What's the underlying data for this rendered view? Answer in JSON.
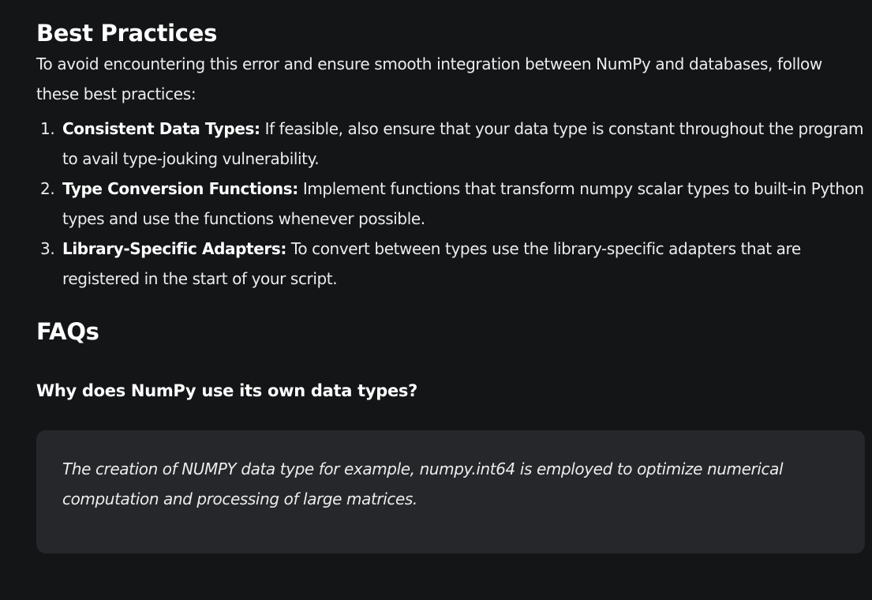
{
  "best_practices": {
    "heading": "Best Practices",
    "intro": "To avoid encountering this error and ensure smooth integration between NumPy and databases, follow these best practices:",
    "items": [
      {
        "number": "1.",
        "term": "Consistent Data Types:",
        "text": " If feasible, also ensure that your data type is constant throughout the program to avail type-jouking vulnerability."
      },
      {
        "number": "2.",
        "term": "Type Conversion Functions:",
        "text": " Implement functions that transform numpy scalar types to built-in Python types and use the functions whenever possible."
      },
      {
        "number": "3.",
        "term": "Library-Specific Adapters:",
        "text": " To convert between types use the library-specific adapters that are registered in the start of your script."
      }
    ]
  },
  "faqs": {
    "heading": "FAQs",
    "questions": [
      {
        "question": "Why does NumPy use its own data types?",
        "answer": "The creation of NUMPY data type for example, numpy.int64 is employed to optimize numerical computation and processing of large matrices."
      }
    ]
  }
}
